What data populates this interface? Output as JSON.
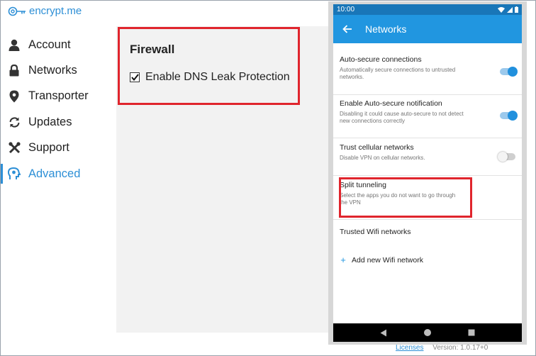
{
  "app": {
    "logo_text": "encrypt.me",
    "accent_color": "#2d8fd6",
    "highlight_color": "#e0252d"
  },
  "sidebar": {
    "items": [
      {
        "label": "Account",
        "icon": "user-icon",
        "active": false
      },
      {
        "label": "Networks",
        "icon": "lock-icon",
        "active": false
      },
      {
        "label": "Transporter",
        "icon": "location-pin-icon",
        "active": false
      },
      {
        "label": "Updates",
        "icon": "refresh-icon",
        "active": false
      },
      {
        "label": "Support",
        "icon": "tools-icon",
        "active": false
      },
      {
        "label": "Advanced",
        "icon": "head-gear-icon",
        "active": true
      }
    ]
  },
  "firewall": {
    "title": "Firewall",
    "checkbox_label": "Enable DNS Leak Protection",
    "checked": true
  },
  "footer": {
    "licenses_link": "Licenses",
    "version_text": "Version: 1.0.17+0"
  },
  "phone": {
    "status_time": "10:00",
    "appbar_title": "Networks",
    "settings": [
      {
        "title": "Auto-secure connections",
        "desc": "Automatically secure connections to untrusted networks.",
        "toggle": true
      },
      {
        "title": "Enable Auto-secure notification",
        "desc": "Disabling it could cause auto-secure to not detect new connections correctly",
        "toggle": true
      },
      {
        "title": "Trust cellular networks",
        "desc": "Disable VPN on cellular networks.",
        "toggle": false
      },
      {
        "title": "Split tunneling",
        "desc": "Select the apps you do not want to go through the VPN"
      }
    ],
    "trusted_wifi_label": "Trusted Wifi networks",
    "add_wifi_label": "Add new Wifi network"
  }
}
